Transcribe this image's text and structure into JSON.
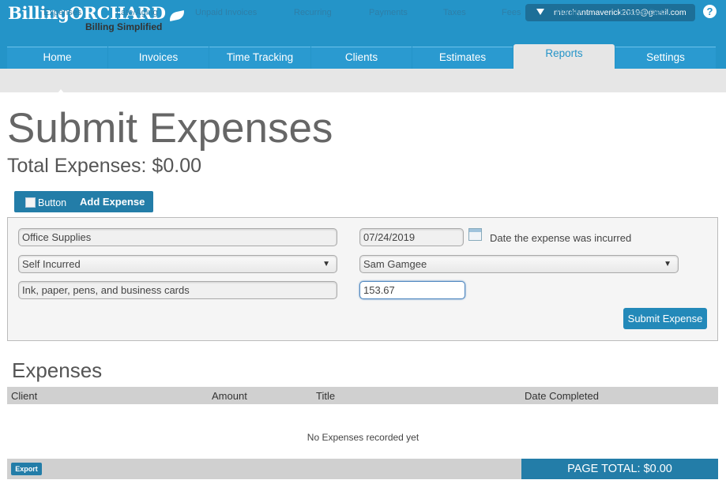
{
  "header": {
    "logo_main": "BillingORCHARD",
    "logo_tagline": "Billing Simplified",
    "user_email": "merchantmaverick2019@gmail.com",
    "help_label": "?"
  },
  "nav": {
    "tabs": [
      {
        "label": "Home",
        "active": false
      },
      {
        "label": "Invoices",
        "active": false
      },
      {
        "label": "Time Tracking",
        "active": false
      },
      {
        "label": "Clients",
        "active": false
      },
      {
        "label": "Estimates",
        "active": false
      },
      {
        "label": "Reports",
        "active": true
      },
      {
        "label": "Settings",
        "active": false
      }
    ]
  },
  "subnav": {
    "items": [
      "Expenses",
      "Late/Aging",
      "Unpaid Invoices",
      "Recurring",
      "Payments",
      "Taxes",
      "Fees",
      "Hourly",
      "Invoice Detail"
    ],
    "selected": "Expenses"
  },
  "page": {
    "title": "Submit Expenses",
    "total_label": "Total Expenses: $0.00"
  },
  "add_expense": {
    "image_alt": "Button",
    "label": "Add Expense"
  },
  "form": {
    "category": "Office Supplies",
    "date": "07/24/2019",
    "date_hint": "Date the expense was incurred",
    "source_select": "Self Incurred",
    "person_select": "Sam Gamgee",
    "description": "Ink, paper, pens, and business cards",
    "amount": "153.67",
    "submit_label": "Submit Expense",
    "select_arrow": "▼"
  },
  "expenses": {
    "title": "Expenses",
    "columns": [
      "Client",
      "Amount",
      "Title",
      "Date Completed"
    ],
    "empty_message": "No Expenses recorded yet",
    "export_label": "Export",
    "page_total": "PAGE TOTAL: $0.00"
  },
  "colors": {
    "header_blue": "#2494c8",
    "button_blue": "#237da8",
    "subnav_gray": "#e6e6e6"
  },
  "icons": {
    "user_menu": "caret-down-icon",
    "help": "help-icon",
    "calendar": "calendar-icon",
    "leaf": "leaf-icon"
  }
}
